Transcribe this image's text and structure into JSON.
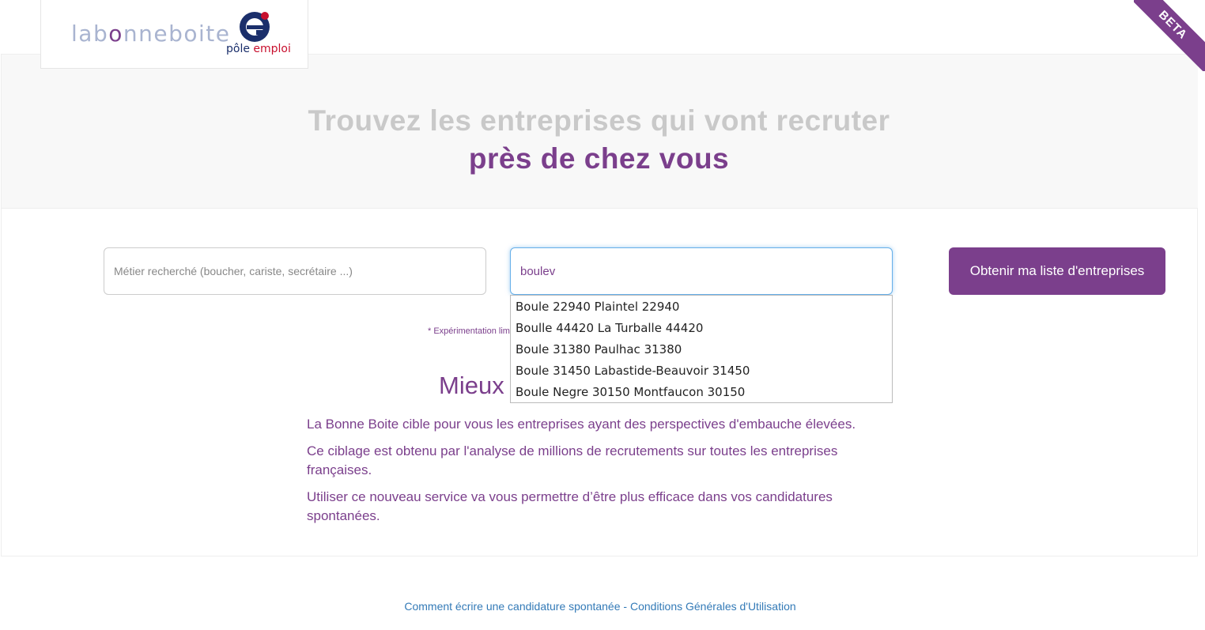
{
  "brand": {
    "site_logo_prefix": "lab",
    "site_logo_o": "o",
    "site_logo_suffix": "nneboite",
    "partner_logo_text_a": "pôle ",
    "partner_logo_text_b": "emploi",
    "ribbon": "BETA",
    "colors": {
      "accent": "#7b3f8c",
      "link": "#337ab7",
      "muted": "#c9c9c9"
    }
  },
  "hero": {
    "line1": "Trouvez les entreprises qui vont recruter",
    "line2": "près de chez vous"
  },
  "search": {
    "job_placeholder": "Métier recherché (boucher, cariste, secrétaire ...)",
    "job_value": "",
    "location_value": "boulev",
    "submit_label": "Obtenir ma liste d'entreprises"
  },
  "autocomplete": {
    "items": [
      "Boule 22940 Plaintel 22940",
      "Boulle 44420 La Turballe 44420",
      "Boule 31380 Paulhac 31380",
      "Boule 31450 Labastide-Beauvoir 31450",
      "Boule Negre 30150 Montfaucon 30150"
    ]
  },
  "main": {
    "note": "* Expérimentation limi",
    "section_title": "Mieux",
    "paragraphs": [
      "La Bonne Boite cible pour vous les entreprises ayant des perspectives d'embauche élevées.",
      "Ce ciblage est obtenu par l'analyse de millions de recrutements sur toutes les entreprises françaises.",
      "Utiliser ce nouveau service va vous permettre d’être plus efficace dans vos candidatures spontanées."
    ]
  },
  "footer": {
    "link1": "Comment écrire une candidature spontanée",
    "separator": " - ",
    "link2": "Conditions Générales d'Utilisation"
  }
}
